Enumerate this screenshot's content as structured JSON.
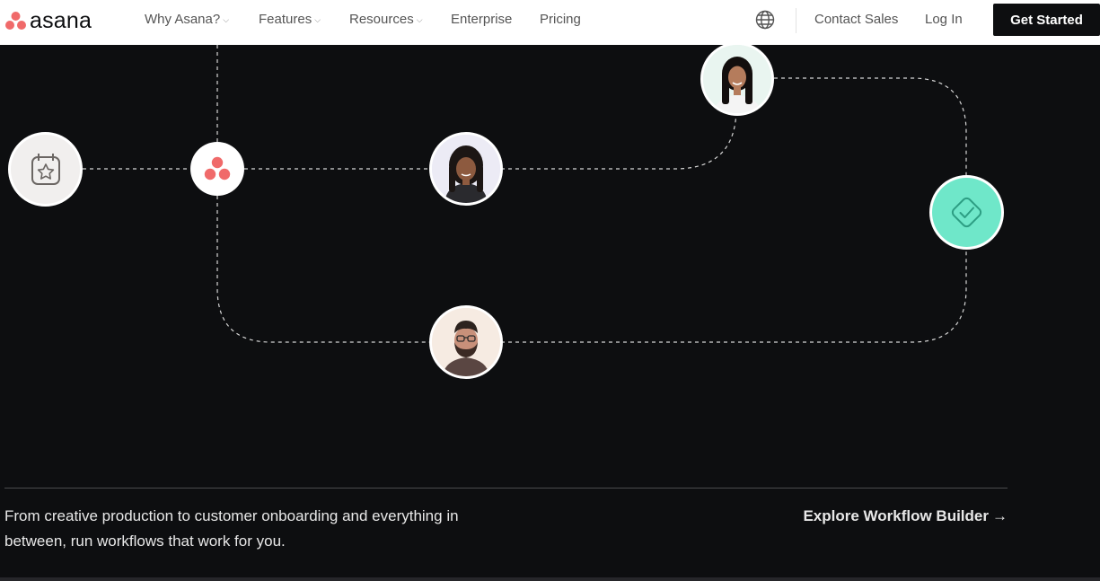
{
  "brand": {
    "name": "asana",
    "accent": "#f06a6a"
  },
  "nav": {
    "items": [
      {
        "label": "Why Asana?",
        "has_dropdown": true
      },
      {
        "label": "Features",
        "has_dropdown": true
      },
      {
        "label": "Resources",
        "has_dropdown": true
      },
      {
        "label": "Enterprise",
        "has_dropdown": false
      },
      {
        "label": "Pricing",
        "has_dropdown": false
      }
    ],
    "chevron": "⌵",
    "globe_icon": "globe-icon",
    "contact_sales": "Contact Sales",
    "log_in": "Log In",
    "get_started": "Get Started"
  },
  "workflow": {
    "nodes": [
      {
        "name": "calendar-star-icon",
        "kind": "icon"
      },
      {
        "name": "asana-logo-icon",
        "kind": "icon"
      },
      {
        "name": "avatar-woman-curly-hair",
        "kind": "avatar"
      },
      {
        "name": "avatar-woman-long-hair",
        "kind": "avatar"
      },
      {
        "name": "avatar-man-glasses-beard",
        "kind": "avatar"
      },
      {
        "name": "check-diamond-icon",
        "kind": "icon",
        "color": "#6fe7c9"
      }
    ]
  },
  "section": {
    "tagline": "From creative production to customer onboarding and everything in between, run workflows that work for you.",
    "explore_link": "Explore Workflow Builder",
    "explore_arrow": "→"
  },
  "colors": {
    "background": "#0d0e10",
    "nav_background": "#ffffff",
    "cta_background": "#0d0e10",
    "connector": "#d6d6d6"
  }
}
